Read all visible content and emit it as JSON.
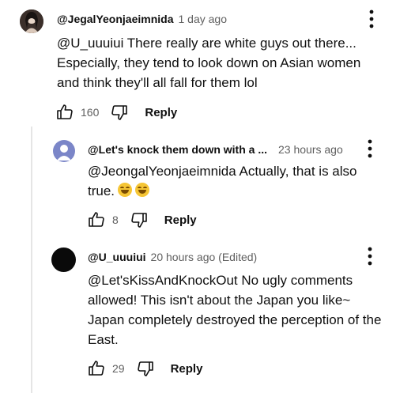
{
  "comments": [
    {
      "author": "@JegalYeonjaeimnida",
      "time": "1 day ago",
      "text": "@U_uuuiui There really are white guys out there... Especially, they tend to look down on Asian women and think they'll all fall for them lol",
      "likes": "160",
      "reply_label": "Reply"
    },
    {
      "author": "@Let's knock them down with a ...",
      "time": "23 hours ago",
      "text": "@JeongalYeonjaeimnida Actually, that is also true.",
      "emojis": [
        "😂",
        "😂"
      ],
      "likes": "8",
      "reply_label": "Reply",
      "avatar_color": "#7b86c8"
    },
    {
      "author": "@U_uuuiui",
      "time": "20 hours ago (Edited)",
      "text": "@Let'sKissAndKnockOut No ugly comments allowed! This isn't about the Japan you like~ Japan completely destroyed the perception of the East.",
      "likes": "29",
      "reply_label": "Reply",
      "avatar_color": "#0a0a0a"
    }
  ]
}
